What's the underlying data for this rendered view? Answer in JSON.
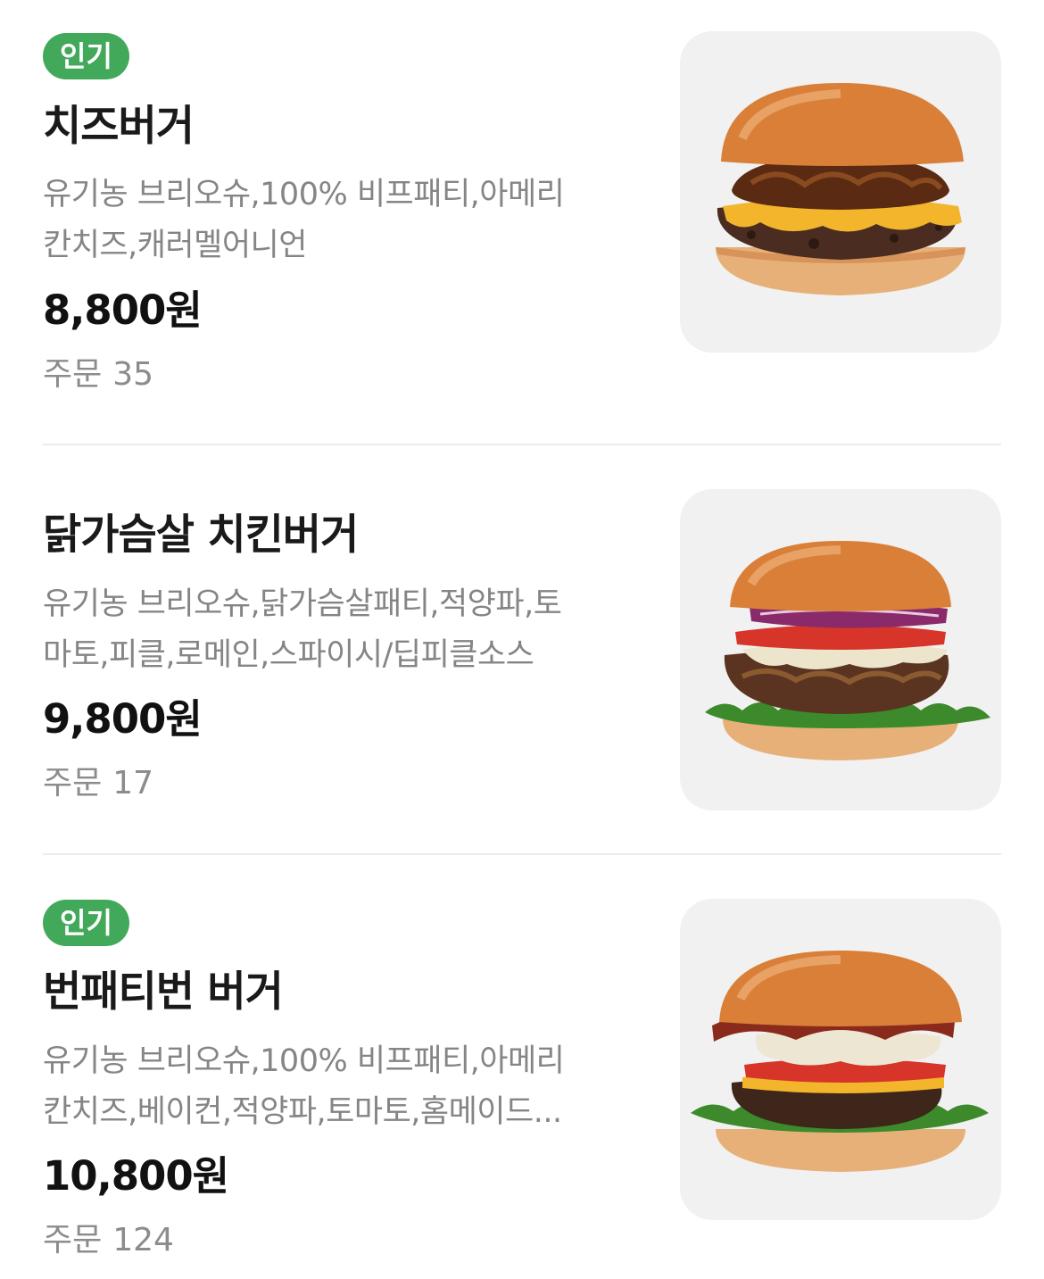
{
  "colors": {
    "badge_background": "#42a85a",
    "badge_text": "#ffffff",
    "description_text": "#858585",
    "orders_text": "#8c8c8c",
    "thumbnail_background": "#f1f1f1",
    "divider": "#ececec"
  },
  "menu": {
    "items": [
      {
        "badge": "인기",
        "name": "치즈버거",
        "description_lines": [
          "유기농 브리오슈,100% 비프패티,아메리",
          "칸치즈,캐러멜어니언"
        ],
        "price": "8,800원",
        "orders_label": "주문",
        "orders_count": "35",
        "image_icon": "cheeseburger-photo"
      },
      {
        "badge": "",
        "name": "닭가슴살 치킨버거",
        "description_lines": [
          "유기농 브리오슈,닭가슴살패티,적양파,토",
          "마토,피클,로메인,스파이시/딥피클소스"
        ],
        "price": "9,800원",
        "orders_label": "주문",
        "orders_count": "17",
        "image_icon": "chicken-burger-photo"
      },
      {
        "badge": "인기",
        "name": "번패티번 버거",
        "description_lines": [
          "유기농 브리오슈,100% 비프패티,아메리",
          "칸치즈,베이컨,적양파,토마토,홈메이드..."
        ],
        "price": "10,800원",
        "orders_label": "주문",
        "orders_count": "124",
        "image_icon": "bun-patty-bun-burger-photo"
      }
    ]
  }
}
